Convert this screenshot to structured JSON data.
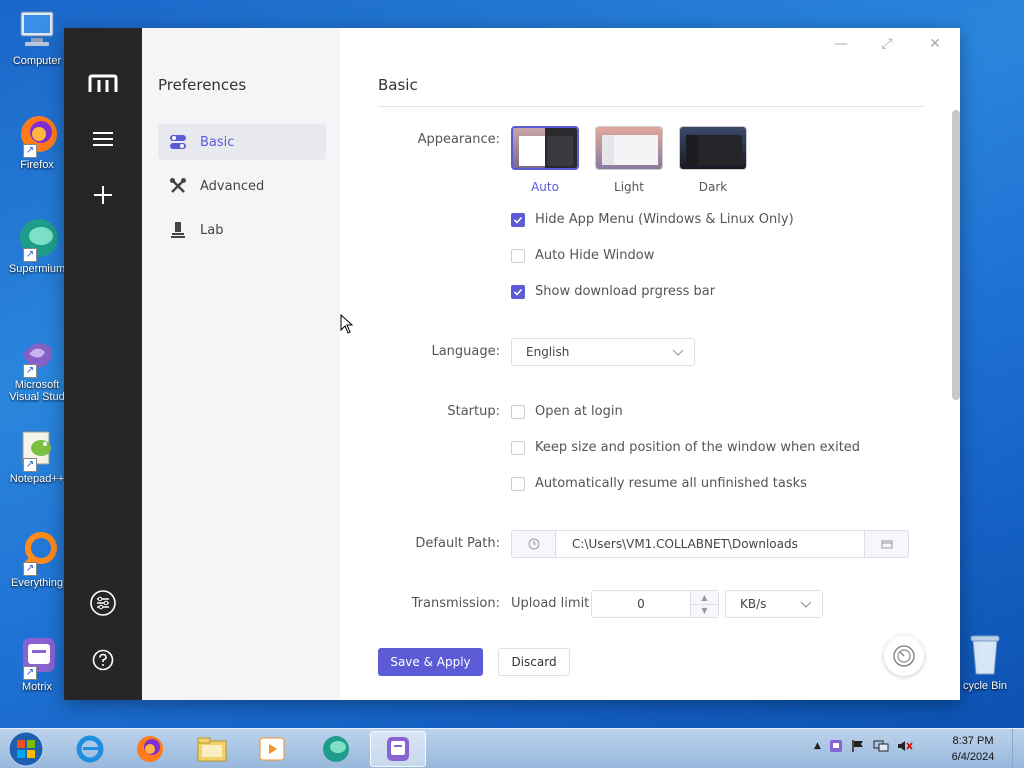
{
  "desktop": {
    "icons": [
      {
        "label": "Computer",
        "icon": "computer-icon"
      },
      {
        "label": "Firefox",
        "icon": "firefox-icon"
      },
      {
        "label": "Supermium",
        "icon": "supermium-icon"
      },
      {
        "label": "Microsoft Visual Stud",
        "icon": "visual-studio-icon"
      },
      {
        "label": "Notepad++",
        "icon": "notepad-plus-plus-icon"
      },
      {
        "label": "Everything",
        "icon": "everything-icon"
      },
      {
        "label": "Motrix",
        "icon": "motrix-icon"
      }
    ],
    "recycle_bin": "cycle Bin"
  },
  "sidebar": {
    "title": "Preferences",
    "items": [
      {
        "label": "Basic",
        "active": true
      },
      {
        "label": "Advanced"
      },
      {
        "label": "Lab"
      }
    ]
  },
  "main": {
    "heading": "Basic",
    "appearance": {
      "label": "Appearance:",
      "themes": [
        {
          "name": "Auto",
          "selected": true
        },
        {
          "name": "Light"
        },
        {
          "name": "Dark"
        }
      ],
      "options": [
        {
          "label": "Hide App Menu (Windows & Linux Only)",
          "checked": true
        },
        {
          "label": "Auto Hide Window",
          "checked": false
        },
        {
          "label": "Show download prgress bar",
          "checked": true
        }
      ]
    },
    "language": {
      "label": "Language:",
      "value": "English"
    },
    "startup": {
      "label": "Startup:",
      "options": [
        {
          "label": "Open at login",
          "checked": false
        },
        {
          "label": "Keep size and position of the window when exited",
          "checked": false
        },
        {
          "label": "Automatically resume all unfinished tasks",
          "checked": false
        }
      ]
    },
    "default_path": {
      "label": "Default Path:",
      "value": "C:\\Users\\VM1.COLLABNET\\Downloads"
    },
    "transmission": {
      "label": "Transmission:",
      "upload_label": "Upload limit",
      "value": "0",
      "unit": "KB/s"
    },
    "save_label": "Save & Apply",
    "discard_label": "Discard"
  },
  "taskbar": {
    "time": "8:37 PM",
    "date": "6/4/2024"
  },
  "colors": {
    "accent": "#5b5bd6",
    "sidebar_dark": "#262626"
  }
}
